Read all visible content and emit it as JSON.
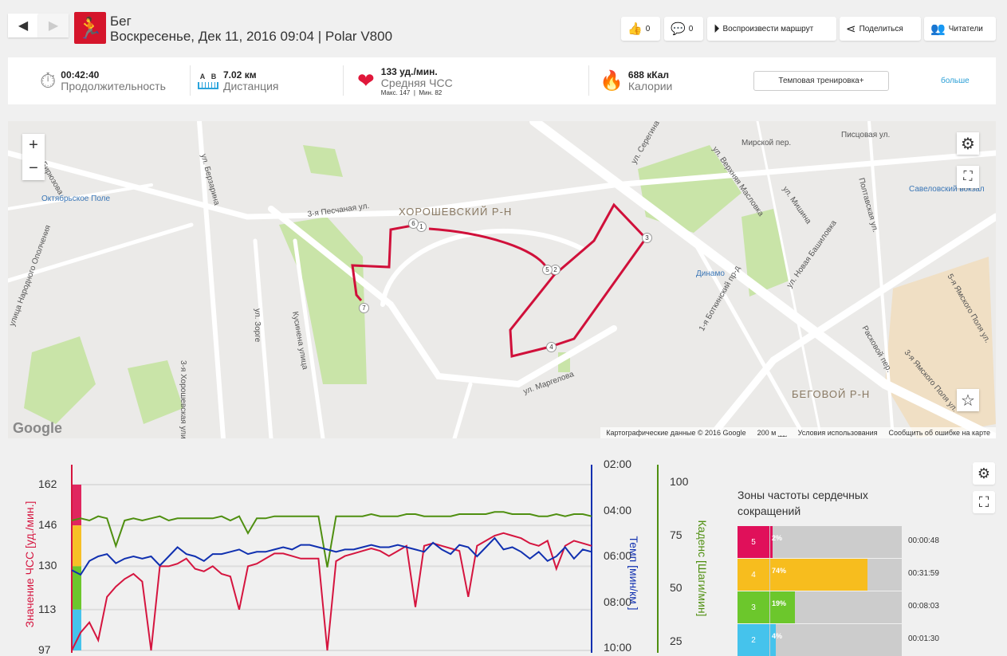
{
  "header": {
    "title": "Бег",
    "subtitle": "Воскресенье, Дек 11, 2016 09:04 | Polar V800",
    "back": "◀",
    "forward": "▶"
  },
  "actions": {
    "likes": "0",
    "comments": "0",
    "play_route": "Воспроизвести маршрут",
    "share": "Поделиться",
    "followers": "Читатели"
  },
  "stats": {
    "duration": {
      "value": "00:42:40",
      "label": "Продолжительность"
    },
    "distance": {
      "a": "A",
      "b": "B",
      "value": "7.02 км",
      "label": "Дистанция"
    },
    "hr": {
      "value": "133 уд./мин.",
      "label": "Средняя ЧСС",
      "max": "Макс. 147",
      "min": "Мин. 82"
    },
    "calories": {
      "value": "688 кКал",
      "label": "Калории"
    },
    "training_type": "Темповая тренировка+",
    "more": "больше"
  },
  "map": {
    "labels": [
      "Октябрьское Поле",
      "ХОРОШЕВСКИЙ Р-Н",
      "3-я Песчаная ул.",
      "ул. Зорге",
      "Кусинена улица",
      "3-я Хорошевская улица",
      "улица Народного Ополчения",
      "Динамо",
      "Савеловский вокзал",
      "БЕГОВОЙ Р-Н",
      "ул. Новая Башиловка",
      "ул. Маргелова",
      "ул. Серегина",
      "Расковой пер.",
      "ул. Бирюзова",
      "ул. Берзарина",
      "5-я Ямского Поля ул.",
      "3-я Ямского Поля ул.",
      "Писцовая ул.",
      "Полтавская ул.",
      "ул. Верхняя Масловка",
      "Мирской пер.",
      "ул. Мишина",
      "1-я Боткинский пр-д"
    ],
    "markers": [
      "1",
      "2",
      "3",
      "4",
      "5",
      "6",
      "7"
    ],
    "attribution": "Картографические данные © 2016 Google",
    "scale": "200 м",
    "terms": "Условия использования",
    "report": "Сообщить об ошибке на карте",
    "logo": "Google",
    "zoom_in": "+",
    "zoom_out": "−"
  },
  "chart_data": {
    "type": "line",
    "left_axis": {
      "label": "Значение ЧСС [уд./мин.]",
      "ticks": [
        "162",
        "146",
        "130",
        "113",
        "97"
      ],
      "range": [
        97,
        162
      ]
    },
    "pace_axis": {
      "label": "Темп [мин/км ]",
      "ticks": [
        "02:00",
        "04:00",
        "06:00",
        "08:00",
        "10:00"
      ],
      "range_min": [
        2,
        10
      ]
    },
    "cadence_axis": {
      "label": "Каденс [Шаги/мин]",
      "ticks": [
        "100",
        "75",
        "50",
        "25"
      ],
      "range": [
        0,
        100
      ]
    },
    "series": [
      {
        "name": "ЧСС",
        "color": "#d5153f",
        "values": [
          97,
          104,
          108,
          101,
          118,
          122,
          125,
          127,
          124,
          97,
          130,
          130,
          131,
          133,
          129,
          128,
          130,
          127,
          126,
          113,
          130,
          131,
          133,
          135,
          135,
          134,
          133,
          133,
          133,
          97,
          132,
          134,
          135,
          136,
          137,
          136,
          134,
          136,
          138,
          114,
          138,
          139,
          138,
          137,
          136,
          118,
          138,
          140,
          142,
          143,
          142,
          141,
          139,
          138,
          140,
          129,
          138,
          140,
          139,
          138
        ]
      },
      {
        "name": "Темп",
        "color": "#1030b0",
        "values": [
          6.6,
          6.8,
          6.2,
          6.0,
          5.9,
          6.3,
          6.1,
          6.0,
          6.1,
          6.0,
          6.4,
          6.0,
          5.6,
          5.9,
          6.0,
          6.2,
          5.9,
          5.9,
          5.8,
          5.7,
          5.9,
          5.8,
          5.8,
          5.7,
          5.6,
          5.7,
          5.5,
          5.5,
          5.6,
          5.7,
          5.8,
          5.7,
          5.7,
          5.6,
          5.5,
          5.6,
          5.6,
          5.5,
          5.6,
          5.7,
          5.8,
          5.4,
          5.7,
          5.9,
          5.5,
          5.6,
          6.0,
          5.6,
          5.2,
          5.7,
          5.6,
          5.8,
          6.1,
          5.8,
          6.2,
          6.0,
          5.6,
          6.1,
          5.7,
          5.8
        ]
      },
      {
        "name": "Каденс",
        "color": "#4f8f10",
        "values": [
          82,
          83,
          82,
          84,
          83,
          70,
          82,
          83,
          82,
          83,
          84,
          82,
          83,
          83,
          83,
          83,
          83,
          84,
          82,
          84,
          76,
          83,
          83,
          84,
          84,
          84,
          84,
          84,
          84,
          60,
          84,
          84,
          84,
          84,
          85,
          84,
          84,
          84,
          85,
          85,
          84,
          84,
          84,
          84,
          85,
          85,
          85,
          85,
          86,
          86,
          85,
          85,
          85,
          84,
          84,
          85,
          84,
          85,
          85,
          84
        ]
      }
    ],
    "zone_bands": [
      "#e0265f",
      "#f7c026",
      "#6cc72c",
      "#45c3ec"
    ]
  },
  "zones": {
    "title": "Зоны частоты сердечных сокращений",
    "rows": [
      {
        "zone": "5",
        "pct": "2%",
        "fraction": 0.02,
        "time": "00:00:48",
        "color": "#e0105a"
      },
      {
        "zone": "4",
        "pct": "74%",
        "fraction": 0.74,
        "time": "00:31:59",
        "color": "#f7bd1e"
      },
      {
        "zone": "3",
        "pct": "19%",
        "fraction": 0.19,
        "time": "00:08:03",
        "color": "#6cc72c"
      },
      {
        "zone": "2",
        "pct": "4%",
        "fraction": 0.04,
        "time": "00:01:30",
        "color": "#45c3ec"
      }
    ]
  }
}
